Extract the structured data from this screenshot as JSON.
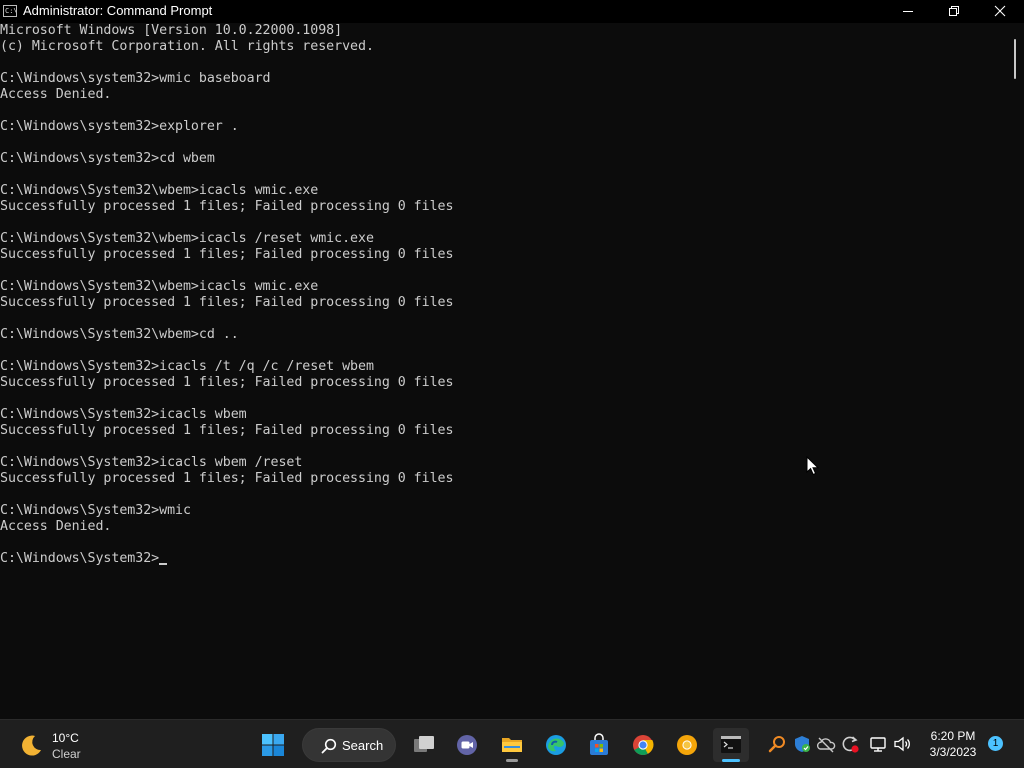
{
  "window": {
    "title": "Administrator: Command Prompt",
    "icon_text": "C:\\"
  },
  "console": {
    "lines": [
      "Microsoft Windows [Version 10.0.22000.1098]",
      "(c) Microsoft Corporation. All rights reserved.",
      "",
      "C:\\Windows\\system32>wmic baseboard",
      "Access Denied.",
      "",
      "C:\\Windows\\system32>explorer .",
      "",
      "C:\\Windows\\system32>cd wbem",
      "",
      "C:\\Windows\\System32\\wbem>icacls wmic.exe",
      "Successfully processed 1 files; Failed processing 0 files",
      "",
      "C:\\Windows\\System32\\wbem>icacls /reset wmic.exe",
      "Successfully processed 1 files; Failed processing 0 files",
      "",
      "C:\\Windows\\System32\\wbem>icacls wmic.exe",
      "Successfully processed 1 files; Failed processing 0 files",
      "",
      "C:\\Windows\\System32\\wbem>cd ..",
      "",
      "C:\\Windows\\System32>icacls /t /q /c /reset wbem",
      "Successfully processed 1 files; Failed processing 0 files",
      "",
      "C:\\Windows\\System32>icacls wbem",
      "Successfully processed 1 files; Failed processing 0 files",
      "",
      "C:\\Windows\\System32>icacls wbem /reset",
      "Successfully processed 1 files; Failed processing 0 files",
      "",
      "C:\\Windows\\System32>wmic",
      "Access Denied.",
      ""
    ],
    "prompt": "C:\\Windows\\System32>"
  },
  "taskbar": {
    "weather": {
      "temp": "10°C",
      "condition": "Clear"
    },
    "search_label": "Search",
    "pinned": [
      {
        "name": "start-button",
        "icon": "windows-logo-icon"
      },
      {
        "name": "task-view-button",
        "icon": "task-view-icon"
      },
      {
        "name": "chat-button",
        "icon": "chat-icon"
      },
      {
        "name": "file-explorer-button",
        "icon": "folder-icon"
      },
      {
        "name": "edge-button",
        "icon": "edge-icon"
      },
      {
        "name": "store-button",
        "icon": "store-icon"
      },
      {
        "name": "chrome-button",
        "icon": "chrome-icon"
      },
      {
        "name": "chrome-canary-button",
        "icon": "chrome-canary-icon"
      },
      {
        "name": "terminal-button",
        "icon": "terminal-icon"
      }
    ],
    "clock": {
      "time": "6:20 PM",
      "date": "3/3/2023"
    },
    "notification_count": "1"
  },
  "colors": {
    "console_bg": "#0c0c0c",
    "console_fg": "#cccccc",
    "taskbar_bg": "#1f1f1f",
    "accent": "#4cc2ff"
  }
}
